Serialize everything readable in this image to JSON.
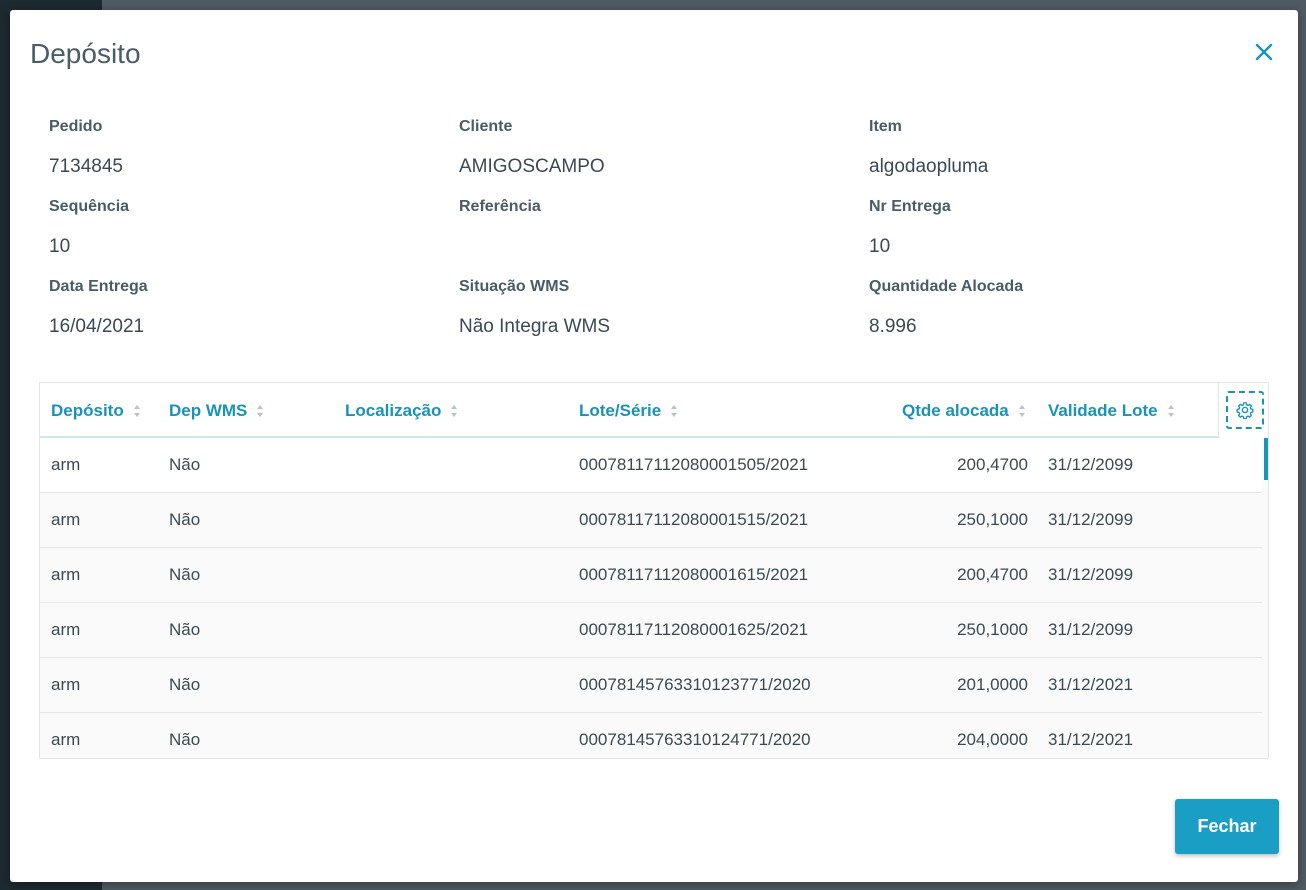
{
  "modal": {
    "title": "Depósito",
    "close_icon": "close-icon",
    "fechar_label": "Fechar"
  },
  "info": {
    "pedido": {
      "label": "Pedido",
      "value": "7134845"
    },
    "cliente": {
      "label": "Cliente",
      "value": "AMIGOSCAMPO"
    },
    "item": {
      "label": "Item",
      "value": "algodaopluma"
    },
    "sequencia": {
      "label": "Sequência",
      "value": "10"
    },
    "referencia": {
      "label": "Referência",
      "value": ""
    },
    "nr_entrega": {
      "label": "Nr Entrega",
      "value": "10"
    },
    "data_entrega": {
      "label": "Data Entrega",
      "value": "16/04/2021"
    },
    "situacao_wms": {
      "label": "Situação WMS",
      "value": "Não Integra WMS"
    },
    "quantidade_alocada": {
      "label": "Quantidade Alocada",
      "value": "8.996"
    }
  },
  "table": {
    "columns": [
      "Depósito",
      "Dep WMS",
      "Localização",
      "Lote/Série",
      "Qtde alocada",
      "Validade Lote"
    ],
    "rows": [
      {
        "deposito": "arm",
        "dep_wms": "Não",
        "localizacao": "",
        "lote": "0007811711208000150​5/2021",
        "qtde": "200,4700",
        "validade": "31/12/2099"
      },
      {
        "deposito": "arm",
        "dep_wms": "Não",
        "localizacao": "",
        "lote": "00078117112080001515/2021",
        "qtde": "250,1000",
        "validade": "31/12/2099"
      },
      {
        "deposito": "arm",
        "dep_wms": "Não",
        "localizacao": "",
        "lote": "00078117112080001615/2021",
        "qtde": "200,4700",
        "validade": "31/12/2099"
      },
      {
        "deposito": "arm",
        "dep_wms": "Não",
        "localizacao": "",
        "lote": "00078117112080001625/2021",
        "qtde": "250,1000",
        "validade": "31/12/2099"
      },
      {
        "deposito": "arm",
        "dep_wms": "Não",
        "localizacao": "",
        "lote": "00078145763310123771/2020",
        "qtde": "201,0000",
        "validade": "31/12/2021"
      },
      {
        "deposito": "arm",
        "dep_wms": "Não",
        "localizacao": "",
        "lote": "00078145763310124771/2020",
        "qtde": "204,0000",
        "validade": "31/12/2021"
      }
    ]
  },
  "colors": {
    "accent": "#1a94b5",
    "button": "#1a9ec3",
    "text": "#3b4a52"
  }
}
